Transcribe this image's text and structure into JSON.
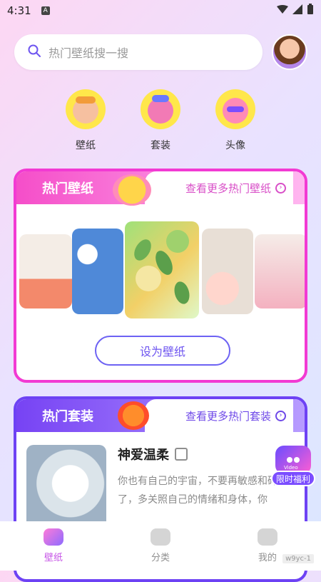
{
  "status": {
    "time": "4:31",
    "indicator": "A",
    "wifi_icon": "wifi-icon",
    "signal_icon": "signal-icon",
    "battery_icon": "battery-icon"
  },
  "search": {
    "placeholder": "热门壁纸搜一搜"
  },
  "categories": [
    {
      "label": "壁纸",
      "icon": "wallpaper-character-icon"
    },
    {
      "label": "套装",
      "icon": "theme-suit-character-icon"
    },
    {
      "label": "头像",
      "icon": "avatar-character-icon"
    }
  ],
  "hot_wallpapers": {
    "title": "热门壁纸",
    "more_text": "查看更多热门壁纸",
    "set_button": "设为壁纸",
    "items": [
      "flowers",
      "blue-cherry-blossom",
      "lemon-kiwi",
      "floating-roses",
      "pink-petals"
    ]
  },
  "hot_suits": {
    "title": "热门套装",
    "more_text": "查看更多热门套装",
    "item_title": "神爱温柔",
    "item_desc": "你也有自己的宇宙，不要再敏感和碎了，多关照自己的情绪和身体，你"
  },
  "promo": {
    "label": "限时福利",
    "video_label": "Video"
  },
  "bottom_nav": [
    {
      "label": "壁纸",
      "active": true
    },
    {
      "label": "分类",
      "active": false
    },
    {
      "label": "我的",
      "active": false
    }
  ],
  "watermark": "w9yc-1",
  "colors": {
    "accent_pink": "#f23ad3",
    "accent_purple": "#6d42f4"
  }
}
